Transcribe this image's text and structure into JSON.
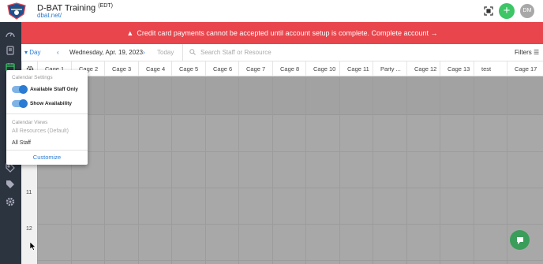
{
  "header": {
    "title": "D-BAT Training",
    "timezone": "(EDT)",
    "url": "dbat.net/",
    "avatar_initials": "DM",
    "add_symbol": "+",
    "logo_icon": "dbat-logo",
    "expand_icon": "expand-icon"
  },
  "alert": {
    "icon": "warning-icon",
    "message": "Credit card payments cannot be accepted until account setup is complete. Complete account →",
    "color": "#e8454c"
  },
  "toolbar": {
    "view": "Day",
    "prev": "‹",
    "date": "Wednesday, Apr. 19, 2023",
    "next": "›",
    "today": "Today",
    "search_placeholder": "Search Staff or Resource",
    "filters": "Filters"
  },
  "columns": [
    "Cage 1",
    "Cage 2",
    "Cage 3",
    "Cage 4",
    "Cage 5",
    "Cage 6",
    "Cage 7",
    "Cage 8",
    "Cage 10",
    "Cage 11",
    "Party ...",
    "Cage 12",
    "Cage 13",
    "test",
    "Cage 17"
  ],
  "hours": [
    "11",
    "12"
  ],
  "settings_panel": {
    "settings_heading": "Calendar Settings",
    "toggle1_label": "Available Staff Only",
    "toggle1_on": true,
    "toggle2_label": "Show Availability",
    "toggle2_on": true,
    "views_heading": "Calendar Views",
    "view_default": "All Resources (Default)",
    "view_staff": "All Staff",
    "customize": "Customize"
  },
  "colors": {
    "accent": "#2a7bd3",
    "add_button": "#3dc566",
    "nav_bg": "#2c3440"
  }
}
